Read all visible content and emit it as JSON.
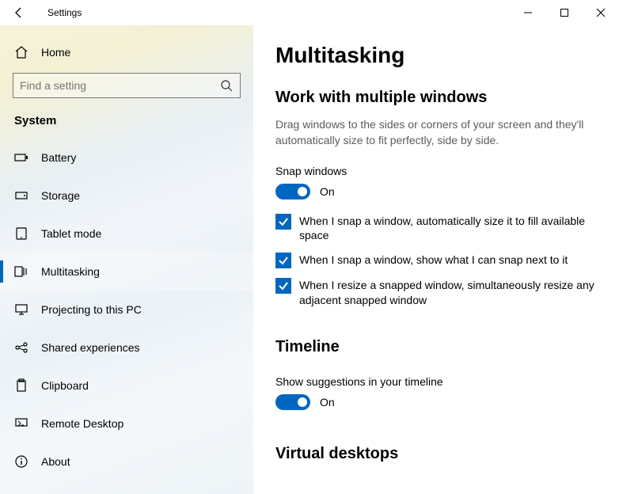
{
  "window": {
    "title": "Settings"
  },
  "sidebar": {
    "home": "Home",
    "search_placeholder": "Find a setting",
    "section": "System",
    "items": [
      {
        "label": "Battery"
      },
      {
        "label": "Storage"
      },
      {
        "label": "Tablet mode"
      },
      {
        "label": "Multitasking"
      },
      {
        "label": "Projecting to this PC"
      },
      {
        "label": "Shared experiences"
      },
      {
        "label": "Clipboard"
      },
      {
        "label": "Remote Desktop"
      },
      {
        "label": "About"
      }
    ]
  },
  "main": {
    "title": "Multitasking",
    "work": {
      "head": "Work with multiple windows",
      "desc": "Drag windows to the sides or corners of your screen and they'll automatically size to fit perfectly, side by side.",
      "snap_label": "Snap windows",
      "snap_state": "On",
      "c1": "When I snap a window, automatically size it to fill available space",
      "c2": "When I snap a window, show what I can snap next to it",
      "c3": "When I resize a snapped window, simultaneously resize any adjacent snapped window"
    },
    "timeline": {
      "head": "Timeline",
      "label": "Show suggestions in your timeline",
      "state": "On"
    },
    "vd": {
      "head": "Virtual desktops"
    }
  }
}
